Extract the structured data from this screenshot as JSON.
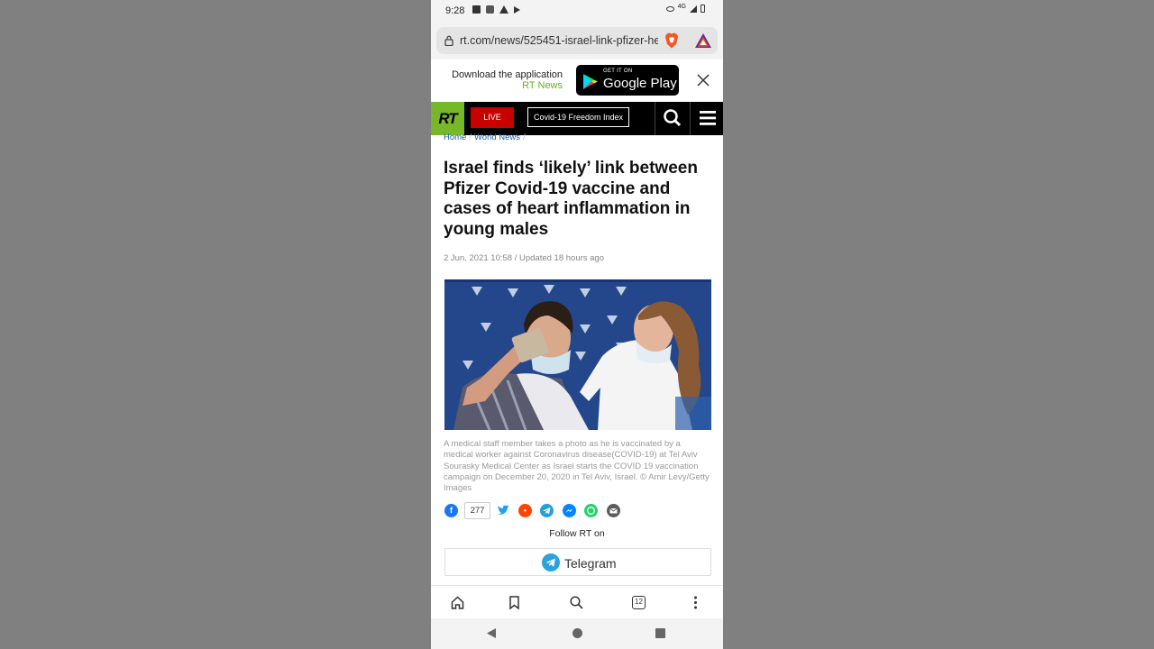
{
  "status_bar": {
    "time": "9:28",
    "network": "4G"
  },
  "browser": {
    "url": "rt.com/news/525451-israel-link-pfizer-hea"
  },
  "app_banner": {
    "text": "Download the application",
    "app_name": "RT News",
    "store_small": "GET IT ON",
    "store_big": "Google Play"
  },
  "site_nav": {
    "logo": "RT",
    "live_label": "LIVE",
    "covid_label": "Covid-19 Freedom Index",
    "brand_color": "#77b82a",
    "live_color": "#c80000"
  },
  "breadcrumb": {
    "items": [
      "Home",
      "World News"
    ]
  },
  "article": {
    "headline": "Israel finds ‘likely’ link between Pfizer Covid-19 vaccine and cases of heart inflammation in young males",
    "dateline": "2 Jun, 2021 10:58 / Updated 18 hours ago",
    "caption": "A medical staff member takes a photo as he is vaccinated by a medical worker against Coronavirus disease(COVID-19) at Tel Aviv Sourasky Medical Center as Israel starts the COVID 19 vaccination campaign on December 20, 2020 in Tel Aviv, Israel. © Amir Levy/Getty Images"
  },
  "share": {
    "count": "277",
    "networks": [
      "facebook-icon",
      "twitter-icon",
      "reddit-icon",
      "telegram-icon",
      "messenger-icon",
      "whatsapp-icon",
      "email-icon"
    ]
  },
  "follow": {
    "label": "Follow RT on",
    "telegram_label": "Telegram"
  },
  "toolbar": {
    "tab_count": "12"
  }
}
